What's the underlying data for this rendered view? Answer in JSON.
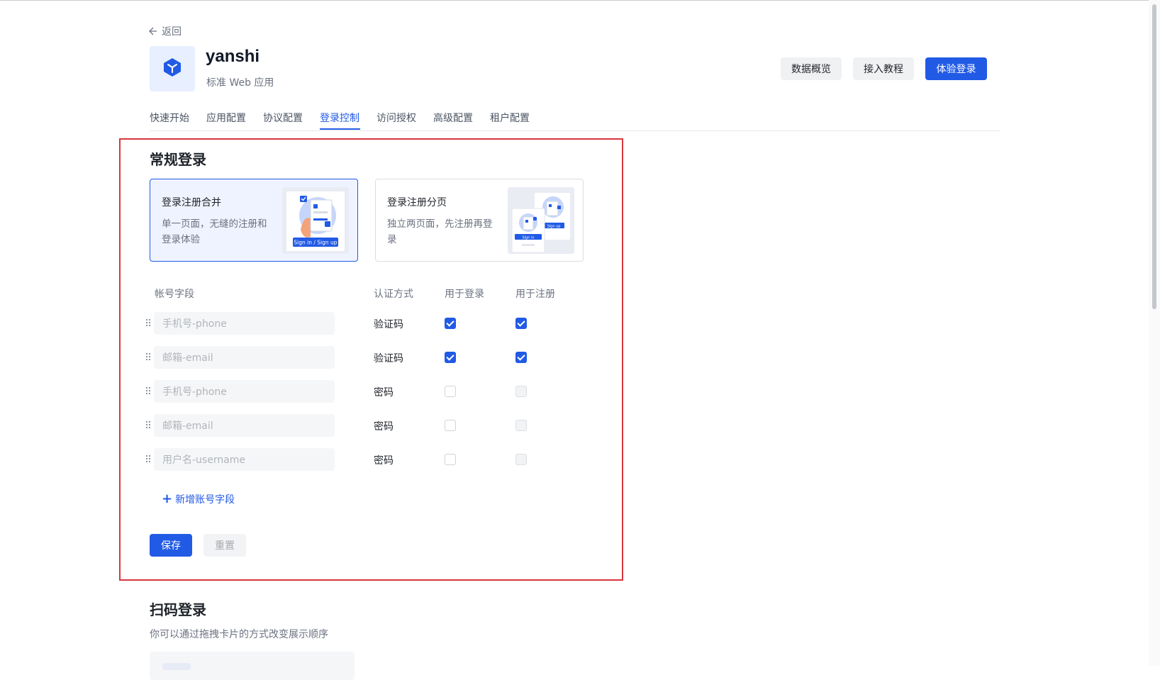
{
  "nav": {
    "back_label": "返回"
  },
  "app": {
    "name": "yanshi",
    "type_label": "标准 Web 应用",
    "brand_color": "#215ae5"
  },
  "header_actions": {
    "overview_label": "数据概览",
    "tutorial_label": "接入教程",
    "try_login_label": "体验登录"
  },
  "tabs": [
    {
      "label": "快速开始",
      "active": false
    },
    {
      "label": "应用配置",
      "active": false
    },
    {
      "label": "协议配置",
      "active": false
    },
    {
      "label": "登录控制",
      "active": true
    },
    {
      "label": "访问授权",
      "active": false
    },
    {
      "label": "高级配置",
      "active": false
    },
    {
      "label": "租户配置",
      "active": false
    }
  ],
  "regular_login": {
    "title": "常规登录",
    "modes": [
      {
        "title": "登录注册合并",
        "desc": "单一页面，无缝的注册和登录体验",
        "badge": "Sign in / Sign up",
        "selected": true
      },
      {
        "title": "登录注册分页",
        "desc": "独立两页面，先注册再登录",
        "badge_signin": "Sign in",
        "badge_signup": "Sign up",
        "selected": false
      }
    ],
    "table_headers": {
      "account_field": "帐号字段",
      "auth_method": "认证方式",
      "for_login": "用于登录",
      "for_register": "用于注册"
    },
    "rows": [
      {
        "field": "手机号-phone",
        "auth": "验证码",
        "login": "checked",
        "register": "checked"
      },
      {
        "field": "邮箱-email",
        "auth": "验证码",
        "login": "checked",
        "register": "checked"
      },
      {
        "field": "手机号-phone",
        "auth": "密码",
        "login": "unchecked",
        "register": "disabled"
      },
      {
        "field": "邮箱-email",
        "auth": "密码",
        "login": "unchecked",
        "register": "disabled"
      },
      {
        "field": "用户名-username",
        "auth": "密码",
        "login": "unchecked",
        "register": "disabled"
      }
    ],
    "add_field_label": "新增账号字段",
    "save_label": "保存",
    "reset_label": "重置"
  },
  "scan_login": {
    "title": "扫码登录",
    "desc": "你可以通过拖拽卡片的方式改变展示顺序"
  },
  "colors": {
    "highlight_border": "#d9363e",
    "selected_card_bg": "#eef3ff"
  }
}
